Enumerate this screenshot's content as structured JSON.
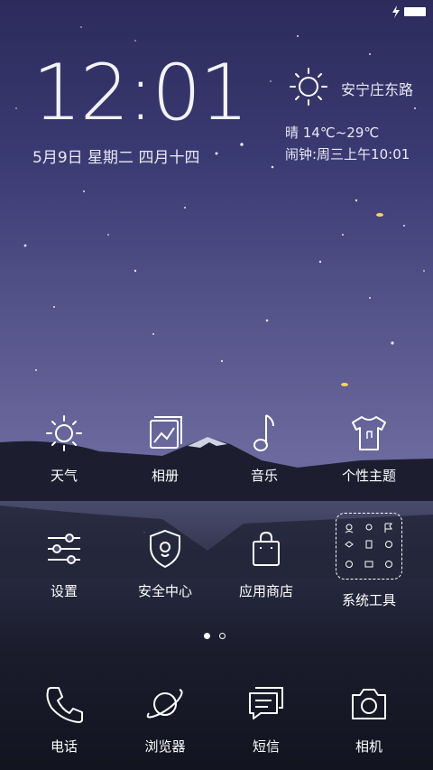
{
  "status": {
    "icons": [
      "charging-icon",
      "battery-icon"
    ]
  },
  "lock": {
    "time": "12:01",
    "date": "5月9日  星期二  四月十四",
    "location": "安宁庄东路",
    "weather": "晴 14℃~29℃",
    "alarm": "闹钟:周三上午10:01"
  },
  "apps_row1": [
    {
      "label": "天气",
      "icon": "sun-icon"
    },
    {
      "label": "相册",
      "icon": "gallery-icon"
    },
    {
      "label": "音乐",
      "icon": "music-note-icon"
    },
    {
      "label": "个性主题",
      "icon": "tshirt-icon"
    }
  ],
  "apps_row2": [
    {
      "label": "设置",
      "icon": "sliders-icon"
    },
    {
      "label": "安全中心",
      "icon": "shield-icon"
    },
    {
      "label": "应用商店",
      "icon": "shopping-bag-icon"
    },
    {
      "label": "系统工具",
      "icon": "folder-icon"
    }
  ],
  "dock": [
    {
      "label": "电话",
      "icon": "phone-icon"
    },
    {
      "label": "浏览器",
      "icon": "planet-icon"
    },
    {
      "label": "短信",
      "icon": "message-icon"
    },
    {
      "label": "相机",
      "icon": "camera-icon"
    }
  ],
  "pager": {
    "pages": 2,
    "current": 1
  }
}
